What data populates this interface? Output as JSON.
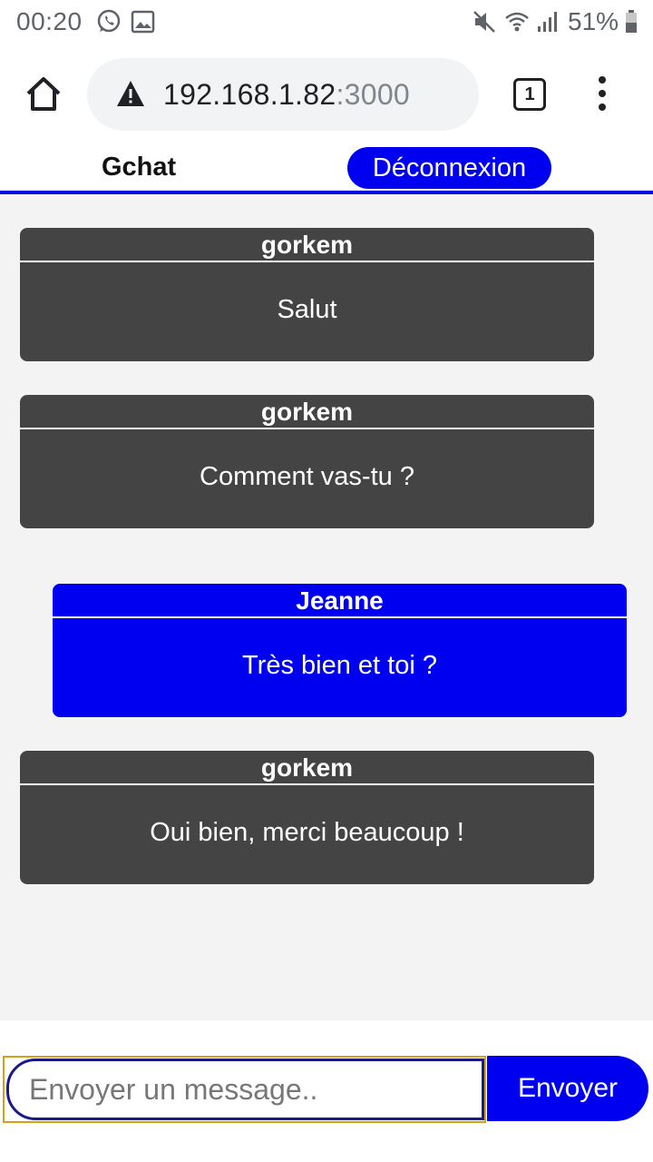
{
  "status_bar": {
    "time": "00:20",
    "battery": "51%",
    "icons": [
      "whatsapp-icon",
      "gallery-icon",
      "mute-icon",
      "wifi-icon",
      "signal-icon",
      "battery-icon"
    ]
  },
  "browser": {
    "url_host": "192.168.1.82",
    "url_port": ":3000",
    "tab_count": "1"
  },
  "app": {
    "title": "Gchat",
    "logout_label": "Déconnexion",
    "accent_color": "#0000f0"
  },
  "messages": [
    {
      "author": "gorkem",
      "text": "Salut",
      "mine": false
    },
    {
      "author": "gorkem",
      "text": "Comment vas-tu ?",
      "mine": false
    },
    {
      "author": "Jeanne",
      "text": "Très bien et toi ?",
      "mine": true
    },
    {
      "author": "gorkem",
      "text": "Oui bien, merci beaucoup !",
      "mine": false
    }
  ],
  "composer": {
    "placeholder": "Envoyer un message..",
    "value": "",
    "send_label": "Envoyer"
  }
}
